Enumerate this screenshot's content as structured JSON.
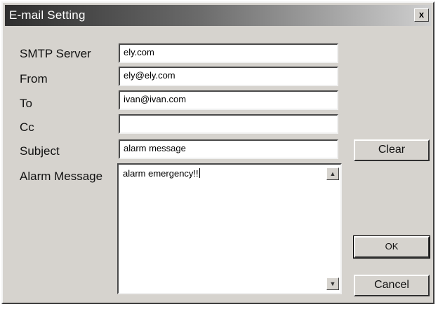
{
  "window": {
    "title": "E-mail Setting",
    "close_glyph": "x"
  },
  "form": {
    "smtp_label": "SMTP Server",
    "smtp_value": "ely.com",
    "from_label": "From",
    "from_value": "ely@ely.com",
    "to_label": "To",
    "to_value": "ivan@ivan.com",
    "cc_label": "Cc",
    "cc_value": "",
    "subject_label": "Subject",
    "subject_value": "alarm message",
    "alarm_label": "Alarm Message",
    "alarm_value": "alarm emergency!!"
  },
  "buttons": {
    "clear": "Clear",
    "ok": "OK",
    "cancel": "Cancel"
  },
  "scrollbar": {
    "up_icon": "scroll-up-arrow",
    "down_icon": "scroll-down-arrow"
  }
}
